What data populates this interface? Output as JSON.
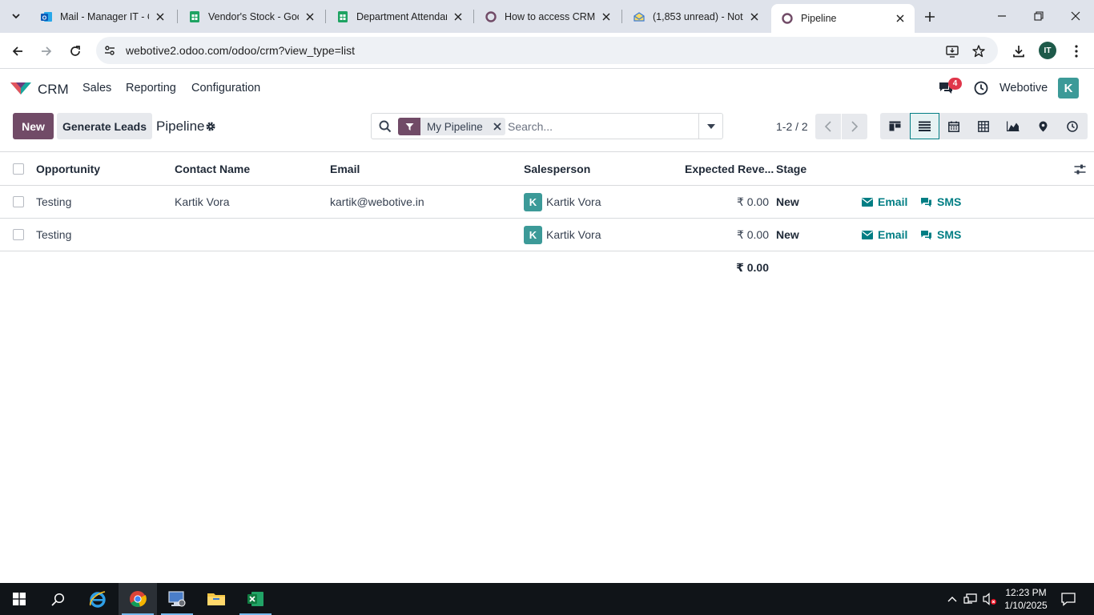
{
  "browser": {
    "tabs": [
      {
        "title": "Mail - Manager IT - O",
        "icon": "outlook-icon"
      },
      {
        "title": "Vendor's Stock - Goo",
        "icon": "google-sheets-icon"
      },
      {
        "title": "Department Attendan",
        "icon": "google-sheets-icon"
      },
      {
        "title": "How to access CRM -",
        "icon": "odoo-icon"
      },
      {
        "title": "(1,853 unread) - Noti",
        "icon": "mail-icon"
      },
      {
        "title": "Pipeline",
        "icon": "odoo-icon"
      }
    ],
    "url": "webotive2.odoo.com/odoo/crm?view_type=list",
    "profile_initials": "IT"
  },
  "navbar": {
    "app_name": "CRM",
    "menus": [
      "Sales",
      "Reporting",
      "Configuration"
    ],
    "chat_badge": "4",
    "company": "Webotive",
    "user_initial": "K"
  },
  "control_panel": {
    "new_label": "New",
    "generate_label": "Generate Leads",
    "breadcrumb": "Pipeline",
    "facet": "My Pipeline",
    "search_placeholder": "Search...",
    "pager": "1-2 / 2"
  },
  "list": {
    "columns": [
      "Opportunity",
      "Contact Name",
      "Email",
      "Salesperson",
      "Expected Reve...",
      "Stage"
    ],
    "rows": [
      {
        "opportunity": "Testing",
        "contact": "Kartik Vora",
        "email": "kartik@webotive.in",
        "salesperson": "Kartik Vora",
        "salesperson_initial": "K",
        "revenue": "₹ 0.00",
        "stage": "New",
        "action_email": "Email",
        "action_sms": "SMS"
      },
      {
        "opportunity": "Testing",
        "contact": "",
        "email": "",
        "salesperson": "Kartik Vora",
        "salesperson_initial": "K",
        "revenue": "₹ 0.00",
        "stage": "New",
        "action_email": "Email",
        "action_sms": "SMS"
      }
    ],
    "total_revenue": "₹ 0.00"
  },
  "taskbar": {
    "time": "12:23 PM",
    "date": "1/10/2025"
  },
  "colors": {
    "odoo_primary": "#714b67",
    "odoo_accent": "#017e84",
    "avatar": "#3c9a98"
  }
}
